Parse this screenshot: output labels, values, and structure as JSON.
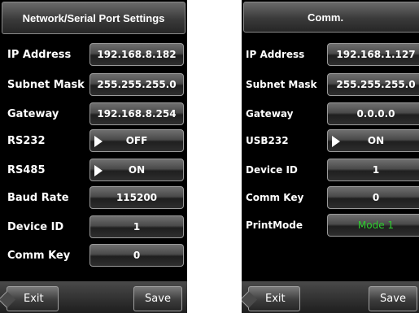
{
  "left": {
    "title": "Network/Serial Port Settings",
    "rows": [
      {
        "label": "IP Address",
        "value": "192.168.8.182"
      },
      {
        "label": "Subnet Mask",
        "value": "255.255.255.0"
      },
      {
        "label": "Gateway",
        "value": "192.168.8.254"
      },
      {
        "label": "RS232",
        "value": "OFF"
      },
      {
        "label": "RS485",
        "value": "ON"
      },
      {
        "label": "Baud Rate",
        "value": "115200"
      },
      {
        "label": "Device ID",
        "value": "1"
      },
      {
        "label": "Comm Key",
        "value": "0"
      }
    ],
    "exit_label": "Exit",
    "save_label": "Save"
  },
  "right": {
    "title": "Comm.",
    "rows": [
      {
        "label": "IP Address",
        "value": "192.168.1.127"
      },
      {
        "label": "Subnet Mask",
        "value": "255.255.255.0"
      },
      {
        "label": "Gateway",
        "value": "0.0.0.0"
      },
      {
        "label": "USB232",
        "value": "ON"
      },
      {
        "label": "Device ID",
        "value": "1"
      },
      {
        "label": "Comm Key",
        "value": "0"
      },
      {
        "label": "PrintMode",
        "value": "Mode 1"
      }
    ],
    "exit_label": "Exit",
    "save_label": "Save"
  },
  "colors": {
    "print_mode_value": "#2ecc2e",
    "background": "#000000"
  }
}
